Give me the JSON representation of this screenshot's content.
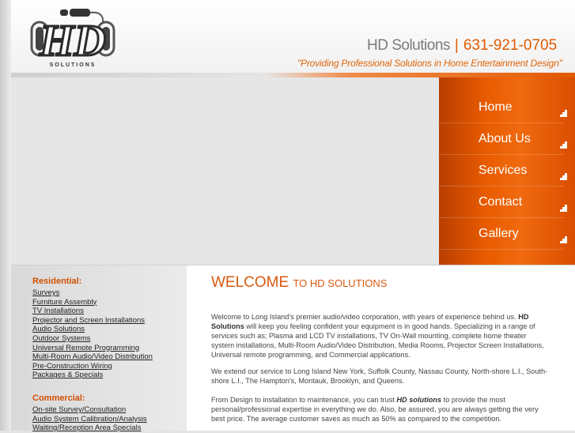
{
  "header": {
    "logo_letters": "HD",
    "logo_sub": "SOLUTIONS",
    "company": "HD Solutions",
    "separator": "|",
    "phone": "631-921-0705",
    "tagline": "\"Providing Professional Solutions in Home Entertainment Design\""
  },
  "nav": [
    {
      "label": "Home"
    },
    {
      "label": "About Us"
    },
    {
      "label": "Services"
    },
    {
      "label": "Contact"
    },
    {
      "label": "Gallery"
    }
  ],
  "sidebar": {
    "residential_heading": "Residential:",
    "residential": [
      "Surveys",
      "Furniture Assembly",
      "TV Installations",
      "Projector and Screen Installations",
      "Audio Solutions",
      "Outdoor Systems",
      "Universal Remote Programming",
      "Multi-Room Audio/Video Distribution",
      "Pre-Construction Wiring",
      "Packages & Specials"
    ],
    "commercial_heading": "Commercial:",
    "commercial": [
      "On-site Survey/Consultation",
      "Audio System Calibration/Analysis",
      "Waiting/Reception Area Specials"
    ]
  },
  "content": {
    "welcome_big": "WELCOME",
    "welcome_small": "TO HD SOLUTIONS",
    "p1_a": "Welcome to Long Island's premier audio/video corporation, with years of experience behind us.",
    "p1_brand": "HD Solutions",
    "p1_b": "will keep you feeling confident your equipment is in good hands. Specializing in a range of services such as; Plasma and LCD TV installations, TV On-Wall mounting, complete home theater system installations, Multi-Room Audio/Video Distribution, Media Rooms, Projector Screen Installations, Universal remote programming, and Commercial applications.",
    "p2": "We extend our service to Long Island New York, Suffolk County, Nassau County, North-shore L.I., South-shore L.I., The Hampton's, Montauk, Brooklyn, and Queens.",
    "p3_a": "From Design to installation to maintenance, you can trust",
    "p3_brand": "HD solutions",
    "p3_b": "to provide the most personal/professional expertise in everything we do. Also, be assured, you are always getting the very best price. The average customer saves as much as 50% as compared to the competition."
  },
  "colors": {
    "accent": "#e05a00",
    "nav_bg": "#e95c00",
    "text": "#444444"
  }
}
